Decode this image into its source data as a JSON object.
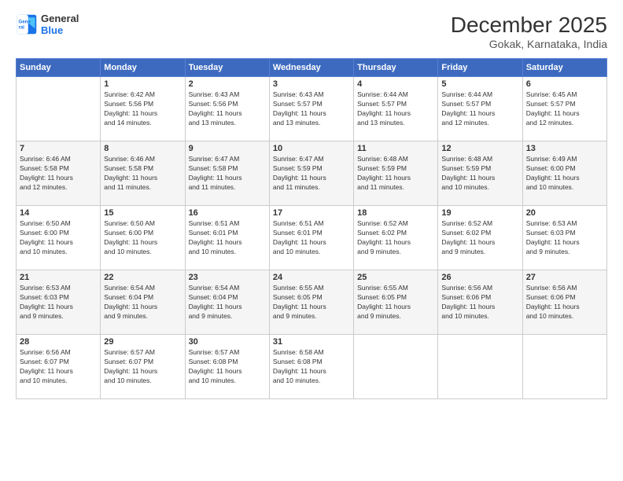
{
  "header": {
    "logo": {
      "line1": "General",
      "line2": "Blue"
    },
    "title": "December 2025",
    "subtitle": "Gokak, Karnataka, India"
  },
  "days_of_week": [
    "Sunday",
    "Monday",
    "Tuesday",
    "Wednesday",
    "Thursday",
    "Friday",
    "Saturday"
  ],
  "weeks": [
    [
      {
        "day": "",
        "info": ""
      },
      {
        "day": "1",
        "info": "Sunrise: 6:42 AM\nSunset: 5:56 PM\nDaylight: 11 hours\nand 14 minutes."
      },
      {
        "day": "2",
        "info": "Sunrise: 6:43 AM\nSunset: 5:56 PM\nDaylight: 11 hours\nand 13 minutes."
      },
      {
        "day": "3",
        "info": "Sunrise: 6:43 AM\nSunset: 5:57 PM\nDaylight: 11 hours\nand 13 minutes."
      },
      {
        "day": "4",
        "info": "Sunrise: 6:44 AM\nSunset: 5:57 PM\nDaylight: 11 hours\nand 13 minutes."
      },
      {
        "day": "5",
        "info": "Sunrise: 6:44 AM\nSunset: 5:57 PM\nDaylight: 11 hours\nand 12 minutes."
      },
      {
        "day": "6",
        "info": "Sunrise: 6:45 AM\nSunset: 5:57 PM\nDaylight: 11 hours\nand 12 minutes."
      }
    ],
    [
      {
        "day": "7",
        "info": "Sunrise: 6:46 AM\nSunset: 5:58 PM\nDaylight: 11 hours\nand 12 minutes."
      },
      {
        "day": "8",
        "info": "Sunrise: 6:46 AM\nSunset: 5:58 PM\nDaylight: 11 hours\nand 11 minutes."
      },
      {
        "day": "9",
        "info": "Sunrise: 6:47 AM\nSunset: 5:58 PM\nDaylight: 11 hours\nand 11 minutes."
      },
      {
        "day": "10",
        "info": "Sunrise: 6:47 AM\nSunset: 5:59 PM\nDaylight: 11 hours\nand 11 minutes."
      },
      {
        "day": "11",
        "info": "Sunrise: 6:48 AM\nSunset: 5:59 PM\nDaylight: 11 hours\nand 11 minutes."
      },
      {
        "day": "12",
        "info": "Sunrise: 6:48 AM\nSunset: 5:59 PM\nDaylight: 11 hours\nand 10 minutes."
      },
      {
        "day": "13",
        "info": "Sunrise: 6:49 AM\nSunset: 6:00 PM\nDaylight: 11 hours\nand 10 minutes."
      }
    ],
    [
      {
        "day": "14",
        "info": "Sunrise: 6:50 AM\nSunset: 6:00 PM\nDaylight: 11 hours\nand 10 minutes."
      },
      {
        "day": "15",
        "info": "Sunrise: 6:50 AM\nSunset: 6:00 PM\nDaylight: 11 hours\nand 10 minutes."
      },
      {
        "day": "16",
        "info": "Sunrise: 6:51 AM\nSunset: 6:01 PM\nDaylight: 11 hours\nand 10 minutes."
      },
      {
        "day": "17",
        "info": "Sunrise: 6:51 AM\nSunset: 6:01 PM\nDaylight: 11 hours\nand 10 minutes."
      },
      {
        "day": "18",
        "info": "Sunrise: 6:52 AM\nSunset: 6:02 PM\nDaylight: 11 hours\nand 9 minutes."
      },
      {
        "day": "19",
        "info": "Sunrise: 6:52 AM\nSunset: 6:02 PM\nDaylight: 11 hours\nand 9 minutes."
      },
      {
        "day": "20",
        "info": "Sunrise: 6:53 AM\nSunset: 6:03 PM\nDaylight: 11 hours\nand 9 minutes."
      }
    ],
    [
      {
        "day": "21",
        "info": "Sunrise: 6:53 AM\nSunset: 6:03 PM\nDaylight: 11 hours\nand 9 minutes."
      },
      {
        "day": "22",
        "info": "Sunrise: 6:54 AM\nSunset: 6:04 PM\nDaylight: 11 hours\nand 9 minutes."
      },
      {
        "day": "23",
        "info": "Sunrise: 6:54 AM\nSunset: 6:04 PM\nDaylight: 11 hours\nand 9 minutes."
      },
      {
        "day": "24",
        "info": "Sunrise: 6:55 AM\nSunset: 6:05 PM\nDaylight: 11 hours\nand 9 minutes."
      },
      {
        "day": "25",
        "info": "Sunrise: 6:55 AM\nSunset: 6:05 PM\nDaylight: 11 hours\nand 9 minutes."
      },
      {
        "day": "26",
        "info": "Sunrise: 6:56 AM\nSunset: 6:06 PM\nDaylight: 11 hours\nand 10 minutes."
      },
      {
        "day": "27",
        "info": "Sunrise: 6:56 AM\nSunset: 6:06 PM\nDaylight: 11 hours\nand 10 minutes."
      }
    ],
    [
      {
        "day": "28",
        "info": "Sunrise: 6:56 AM\nSunset: 6:07 PM\nDaylight: 11 hours\nand 10 minutes."
      },
      {
        "day": "29",
        "info": "Sunrise: 6:57 AM\nSunset: 6:07 PM\nDaylight: 11 hours\nand 10 minutes."
      },
      {
        "day": "30",
        "info": "Sunrise: 6:57 AM\nSunset: 6:08 PM\nDaylight: 11 hours\nand 10 minutes."
      },
      {
        "day": "31",
        "info": "Sunrise: 6:58 AM\nSunset: 6:08 PM\nDaylight: 11 hours\nand 10 minutes."
      },
      {
        "day": "",
        "info": ""
      },
      {
        "day": "",
        "info": ""
      },
      {
        "day": "",
        "info": ""
      }
    ]
  ]
}
